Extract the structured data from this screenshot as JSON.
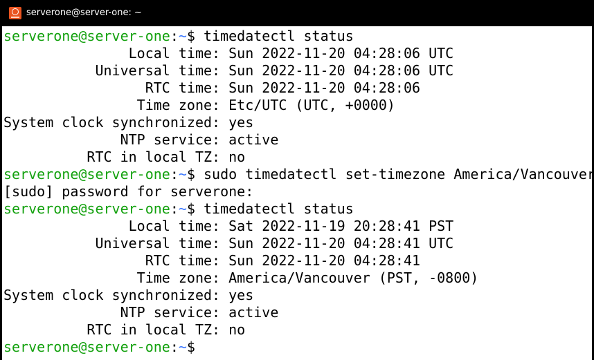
{
  "window": {
    "title": "serverone@server-one: ~",
    "icon": "ubuntu-terminal-icon",
    "colors": {
      "titlebar_bg": "#000000",
      "terminal_bg": "#ffffff",
      "prompt_user": "#13a10e",
      "prompt_path": "#3b78ff",
      "text": "#000000"
    }
  },
  "prompt": {
    "user_host": "serverone@server-one",
    "sep": ":",
    "path": "~",
    "symbol": "$ "
  },
  "lines": [
    {
      "type": "prompt",
      "cmd": "timedatectl status"
    },
    {
      "type": "out",
      "text": "               Local time: Sun 2022-11-20 04:28:06 UTC"
    },
    {
      "type": "out",
      "text": "           Universal time: Sun 2022-11-20 04:28:06 UTC"
    },
    {
      "type": "out",
      "text": "                 RTC time: Sun 2022-11-20 04:28:06"
    },
    {
      "type": "out",
      "text": "                Time zone: Etc/UTC (UTC, +0000)"
    },
    {
      "type": "out",
      "text": "System clock synchronized: yes"
    },
    {
      "type": "out",
      "text": "              NTP service: active"
    },
    {
      "type": "out",
      "text": "          RTC in local TZ: no"
    },
    {
      "type": "prompt",
      "cmd": "sudo timedatectl set-timezone America/Vancouver"
    },
    {
      "type": "out",
      "text": "[sudo] password for serverone:"
    },
    {
      "type": "prompt",
      "cmd": "timedatectl status"
    },
    {
      "type": "out",
      "text": "               Local time: Sat 2022-11-19 20:28:41 PST"
    },
    {
      "type": "out",
      "text": "           Universal time: Sun 2022-11-20 04:28:41 UTC"
    },
    {
      "type": "out",
      "text": "                 RTC time: Sun 2022-11-20 04:28:41"
    },
    {
      "type": "out",
      "text": "                Time zone: America/Vancouver (PST, -0800)"
    },
    {
      "type": "out",
      "text": "System clock synchronized: yes"
    },
    {
      "type": "out",
      "text": "              NTP service: active"
    },
    {
      "type": "out",
      "text": "          RTC in local TZ: no"
    },
    {
      "type": "prompt",
      "cmd": ""
    }
  ]
}
